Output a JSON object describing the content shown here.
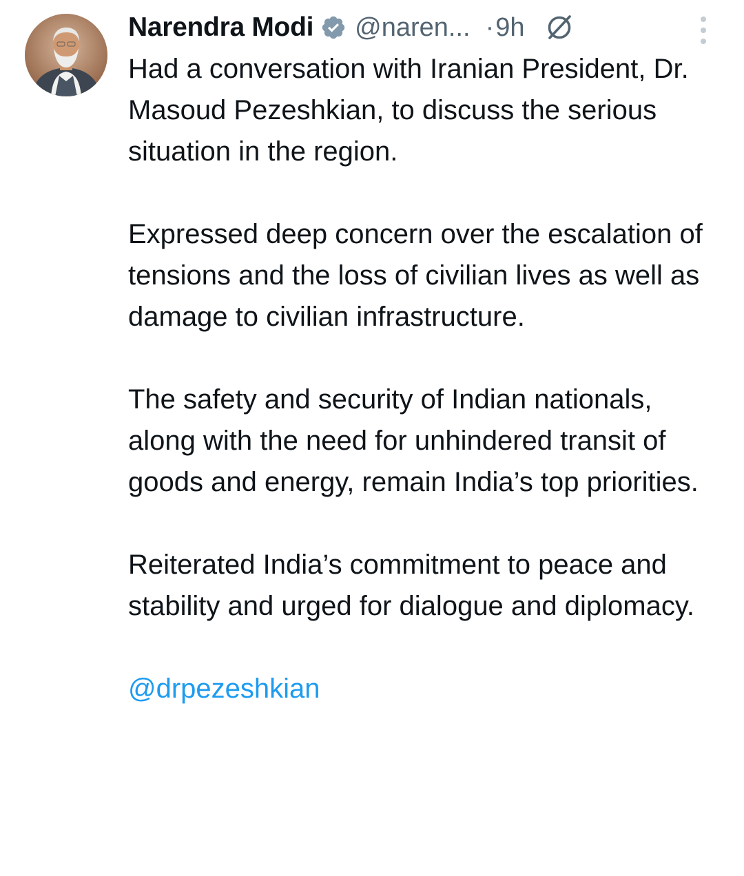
{
  "author": {
    "display_name": "Narendra Modi",
    "handle": "@naren...",
    "verified_badge": "verified-badge-icon",
    "time_separator": "·",
    "timestamp": "9h",
    "avatar": "profile-photo",
    "extra_icon": "grok-icon",
    "menu_icon": "more-vertical-icon"
  },
  "tweet": {
    "paragraphs": [
      "Had a conversation with Iranian President, Dr. Masoud Pezeshkian, to discuss the serious situation in the region.",
      "Expressed deep concern over the escalation of tensions and the loss of civilian lives as well as damage to civilian infrastructure.",
      "The safety and security of Indian nationals, along with the need for unhindered transit of goods and energy, remain India’s top priorities.",
      "Reiterated India’s commitment to peace and stability and urged for dialogue and diplomacy."
    ],
    "mention": "@drpezeshkian"
  },
  "colors": {
    "text_primary": "#0f1419",
    "text_secondary": "#536471",
    "link": "#1d9bf0",
    "verified": "#829aab",
    "background": "#ffffff"
  }
}
